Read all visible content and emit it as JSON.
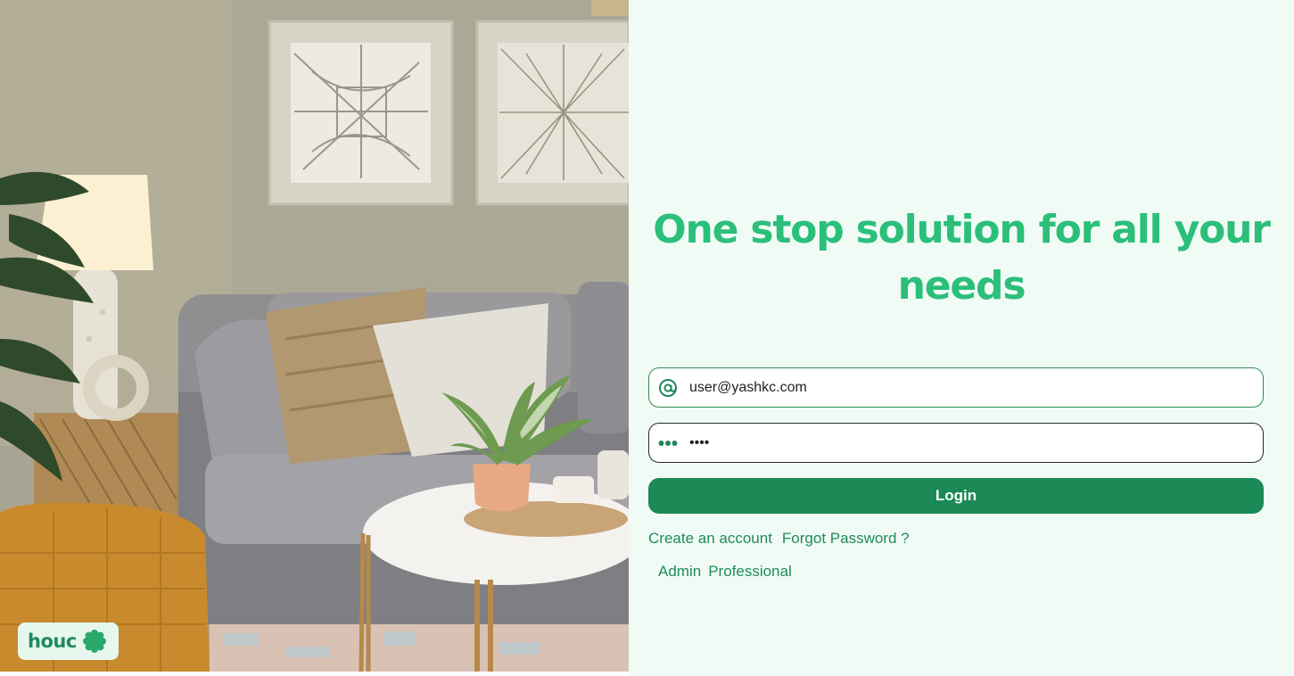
{
  "brand": {
    "name": "houc",
    "icon": "leaf-badge-icon"
  },
  "hero": {
    "image_alt": "Living room with grey sofa, cushions, table lamp, plants and round coffee table"
  },
  "headline": "One stop solution for all your needs",
  "form": {
    "email_value": "user@yashkc.com",
    "email_icon": "at-sign-icon",
    "password_value": "••••",
    "password_icon": "password-dots-icon",
    "login_label": "Login"
  },
  "links": {
    "create_account": "Create an account",
    "forgot_password": "Forgot Password ?",
    "admin": "Admin",
    "professional": "Professional"
  },
  "colors": {
    "accent": "#2bbf7a",
    "button": "#1b8a56",
    "panel_bg": "#f1fbf6",
    "link": "#1f8a5c"
  }
}
